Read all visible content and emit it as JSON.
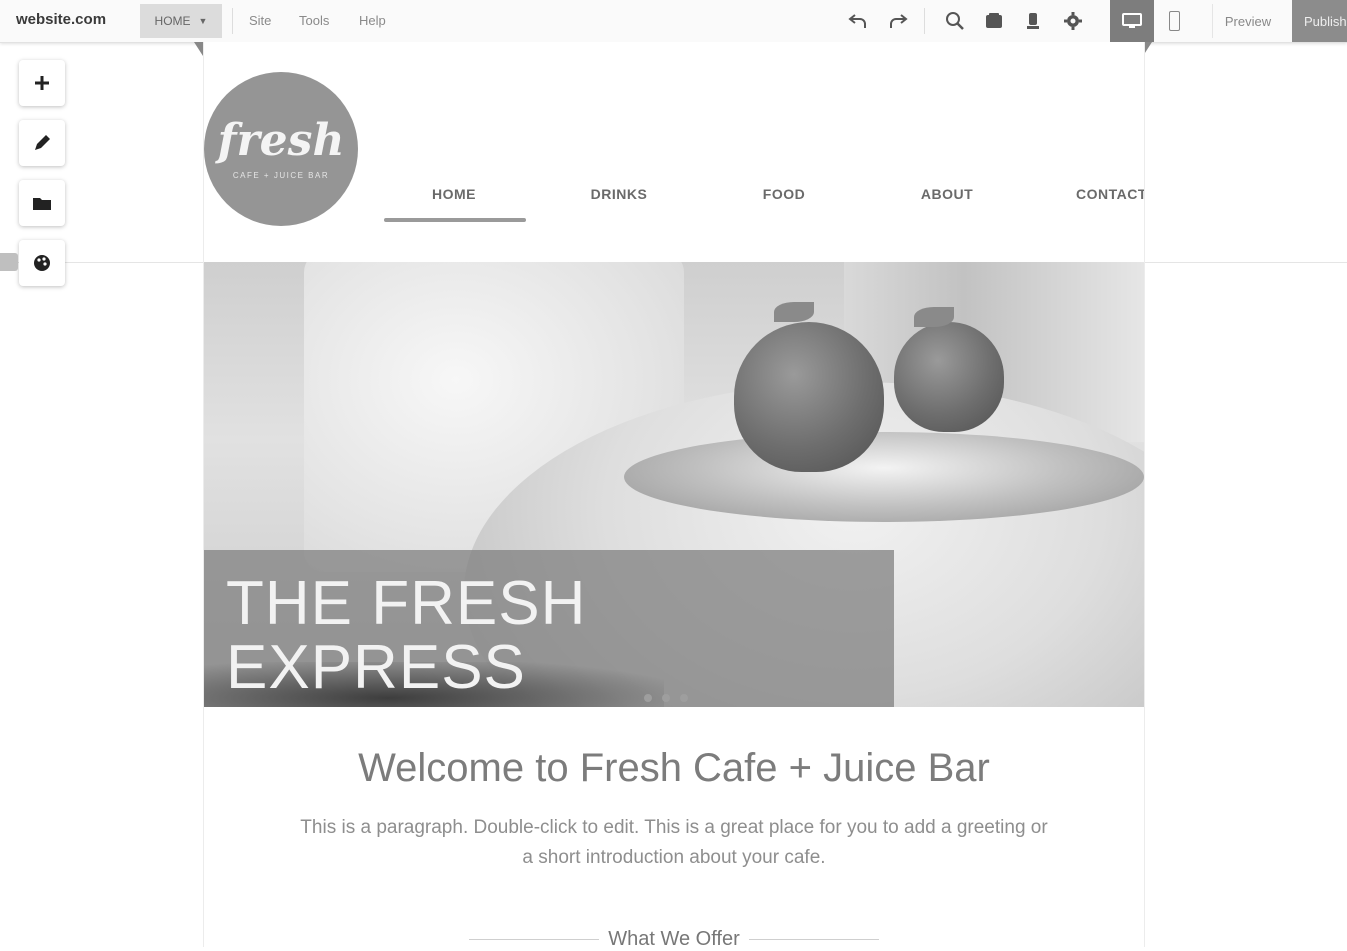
{
  "topbar": {
    "site_name": "website.com",
    "page_selector": {
      "value": "HOME"
    },
    "menu": [
      "Site",
      "Tools",
      "Help"
    ],
    "icons": [
      "undo-icon",
      "redo-icon",
      "zoom-icon",
      "page-icon",
      "upload-icon",
      "settings-icon"
    ],
    "preview_label": "Preview",
    "publish_label": "Publish"
  },
  "tools": [
    "add-icon",
    "pencil-icon",
    "folder-icon",
    "palette-icon"
  ],
  "site": {
    "logo": {
      "word": "fresh",
      "tagline": "CAFE + JUICE BAR"
    },
    "nav": [
      "HOME",
      "DRINKS",
      "FOOD",
      "ABOUT",
      "CONTACT"
    ],
    "nav_active_index": 0,
    "hero": {
      "title_line1": "THE FRESH",
      "title_line2": "EXPRESS",
      "slide_count": 3
    },
    "welcome": {
      "title": "Welcome to Fresh Cafe + Juice Bar",
      "paragraph": "This is a paragraph. Double-click to edit. This is a great place for you to add a greeting or a short introduction about your cafe."
    },
    "section_heading": "What We Offer"
  }
}
